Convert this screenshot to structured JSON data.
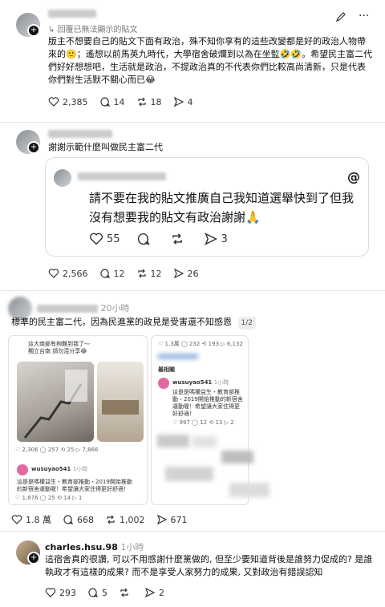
{
  "post1": {
    "reply_label": "回覆已無法顯示的貼文",
    "text": "版主不想要自己的貼文下面有政治，殊不知你享有的這些改變都是好的政治人物帶來的🙂；遙想以前馬英九時代，大學宿舍破爛到以為在坐監🤣🤣。希望民主富二代們好好想想吧，生活就是政治，不提政治真的不代表你們比較高尚清新，只是代表你們對生活默不關心而已😂",
    "likes": "2,385",
    "comments": "14",
    "reposts": "18",
    "shares": "4"
  },
  "post2": {
    "text": "謝謝示範什麼叫做民主富二代",
    "embed_text": "請不要在我的貼文推廣自己我知道選舉快到了但我沒有想要我的貼文有政治謝謝🙏",
    "embed_likes": "55",
    "embed_shares": "3",
    "likes": "2,566",
    "comments": "12",
    "reposts": "12",
    "shares": "26"
  },
  "post3": {
    "time": "20小時",
    "text": "標準的民主富二代，因為民進黨的政見是受害還不知感恩",
    "page_indicator": "1/2",
    "card1": {
      "top_text": "這大南部有夠難到我了～\n獨立台南 請勿混分享😂",
      "stats": [
        "2,306",
        "257",
        "25",
        "7,866"
      ],
      "username": "wusuyao541",
      "time": "1小時",
      "body": "這是是嗎權益生・教育部推動・2019開始推動的新宿舍運動喔！希望讓大家住得更好舒適！",
      "footer_stats": [
        "1,876",
        "25",
        "14",
        "1"
      ]
    },
    "card2": {
      "stats": [
        "1.3萬",
        "232",
        "193",
        "6,132"
      ],
      "tag": "最相關",
      "username": "wusuyao541",
      "time": "1小時",
      "body": "這是是嗎權益生・教育部推動・2019開始推動的新宿舍運動喔！希望讓大家住得更好舒適！",
      "footer_stats": [
        "997",
        "12",
        "13",
        "2"
      ]
    },
    "likes": "1.8 萬",
    "comments": "668",
    "reposts": "1,002",
    "shares": "671"
  },
  "post4": {
    "username": "charles.hsu.98",
    "time": "1小時",
    "text": "這宿舍真的很讚, 可以不用感謝什麼黨做的, 但至少要知道背後是誰努力促成的? 是誰執政才有這樣的成果? 而不是享受人家努力的成果, 又對政治有錯誤認知",
    "likes": "293",
    "comments": "5",
    "reposts": "2"
  },
  "colors": {
    "text": "#111111",
    "muted": "#777777",
    "border": "#e5e5e5"
  },
  "icons": [
    "edit-icon",
    "more-icon",
    "heart-icon",
    "comment-icon",
    "repost-icon",
    "share-icon",
    "threads-logo-icon"
  ]
}
